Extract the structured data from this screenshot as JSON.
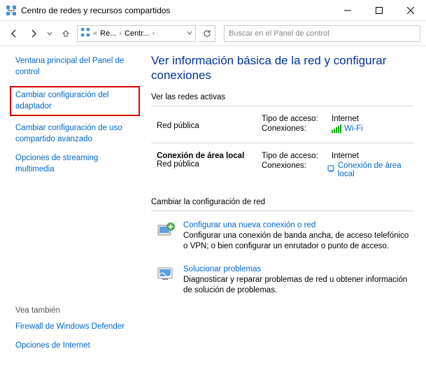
{
  "titlebar": {
    "title": "Centro de redes y recursos compartidos"
  },
  "nav": {
    "crumb1": "Re...",
    "crumb2": "Centr...",
    "search_placeholder": "Buscar en el Panel de control"
  },
  "sidebar": {
    "links": [
      "Ventana principal del Panel de control",
      "Cambiar configuración del adaptador",
      "Cambiar configuración de uso compartido avanzado",
      "Opciones de streaming multimedia"
    ],
    "see_also_label": "Vea también",
    "see_also": [
      "Firewall de Windows Defender",
      "Opciones de Internet"
    ]
  },
  "main": {
    "heading": "Ver información básica de la red y configurar conexiones",
    "active_label": "Ver las redes activas",
    "net1": {
      "name": "Red pública",
      "access_label": "Tipo de acceso:",
      "access_value": "Internet",
      "conn_label": "Conexiones:",
      "conn_value": "Wi-Fi"
    },
    "net2": {
      "name": "Conexión de área local",
      "subtitle": "Red pública",
      "access_label": "Tipo de acceso:",
      "access_value": "Internet",
      "conn_label": "Conexiones:",
      "conn_value": "Conexión de área local"
    },
    "change_label": "Cambiar la configuración de red",
    "cfg1": {
      "link": "Configurar una nueva conexión o red",
      "desc": "Configurar una conexión de banda ancha, de acceso telefónico o VPN; o bien configurar un enrutador o punto de acceso."
    },
    "cfg2": {
      "link": "Solucionar problemas",
      "desc": "Diagnosticar y reparar problemas de red u obtener información de solución de problemas."
    }
  }
}
